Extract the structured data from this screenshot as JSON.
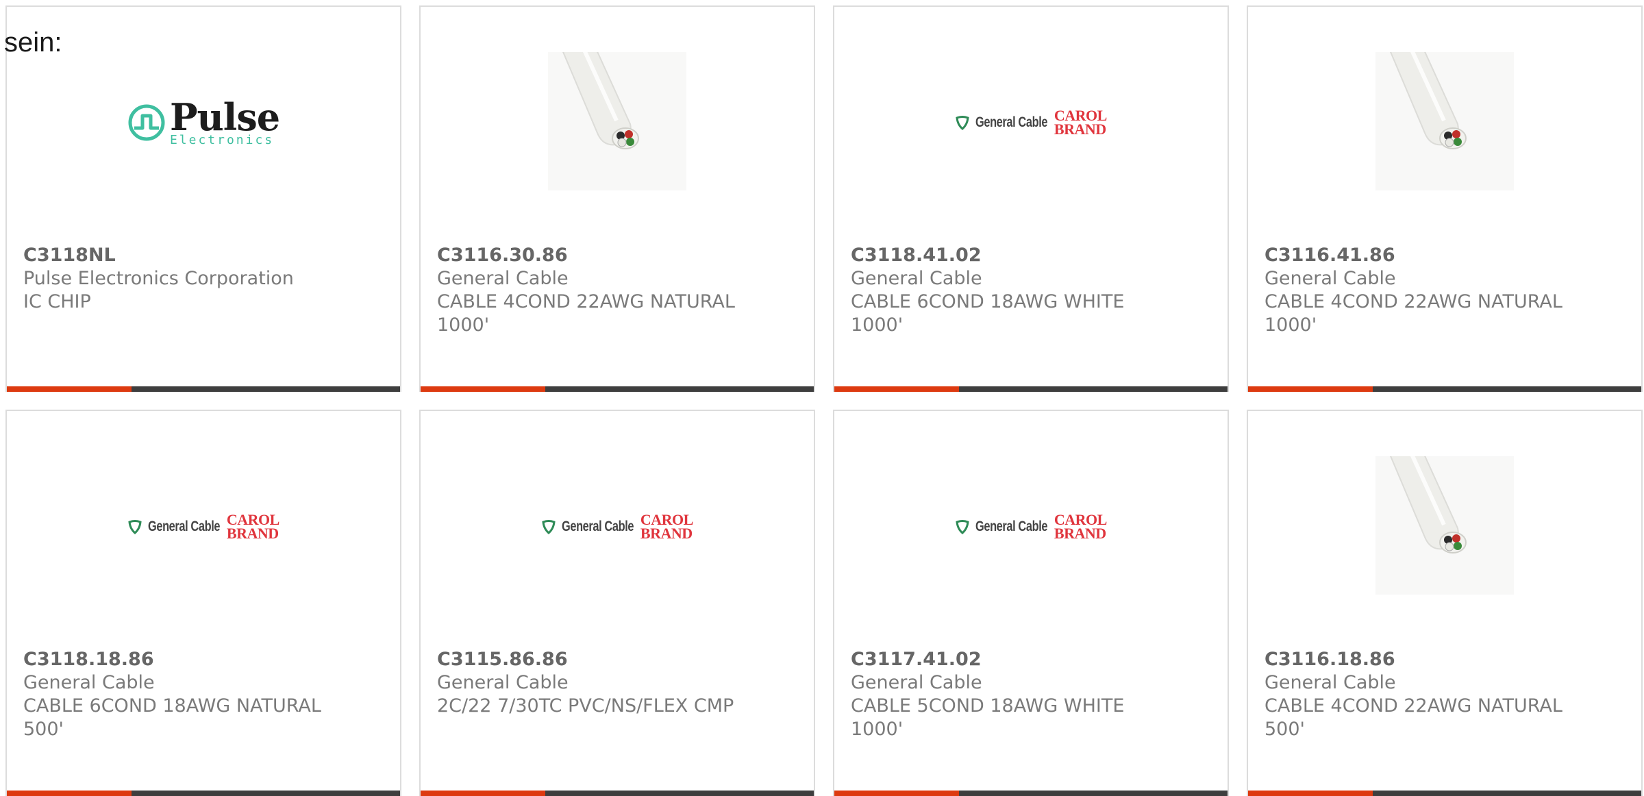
{
  "fragment_text": "sein:",
  "products": [
    {
      "part_number": "C3118NL",
      "manufacturer": "Pulse Electronics Corporation",
      "description": "IC CHIP",
      "image": "pulse-electronics-logo"
    },
    {
      "part_number": "C3116.30.86",
      "manufacturer": "General Cable",
      "description": "CABLE 4COND 22AWG NATURAL 1000'",
      "image": "cable-photo"
    },
    {
      "part_number": "C3118.41.02",
      "manufacturer": "General Cable",
      "description": "CABLE 6COND 18AWG WHITE 1000'",
      "image": "general-cable-logo"
    },
    {
      "part_number": "C3116.41.86",
      "manufacturer": "General Cable",
      "description": "CABLE 4COND 22AWG NATURAL 1000'",
      "image": "cable-photo"
    },
    {
      "part_number": "C3118.18.86",
      "manufacturer": "General Cable",
      "description": "CABLE 6COND 18AWG NATURAL 500'",
      "image": "general-cable-logo"
    },
    {
      "part_number": "C3115.86.86",
      "manufacturer": "General Cable",
      "description": "2C/22 7/30TC PVC/NS/FLEX CMP",
      "image": "general-cable-logo"
    },
    {
      "part_number": "C3117.41.02",
      "manufacturer": "General Cable",
      "description": "CABLE 5COND 18AWG WHITE 1000'",
      "image": "general-cable-logo"
    },
    {
      "part_number": "C3116.18.86",
      "manufacturer": "General Cable",
      "description": "CABLE 4COND 22AWG NATURAL 500'",
      "image": "cable-photo"
    }
  ],
  "logos": {
    "pulse": {
      "name": "Pulse",
      "sub": "Electronics"
    },
    "general_cable": {
      "name": "General Cable",
      "carol": "CAROL",
      "brand": "BRAND"
    }
  },
  "colors": {
    "accent_bar": "#dd3a10",
    "dark_bar": "#3e3e3e",
    "text": "#7a7a7a",
    "pulse_teal": "#3fbfa0",
    "carol_red": "#e0353d"
  }
}
